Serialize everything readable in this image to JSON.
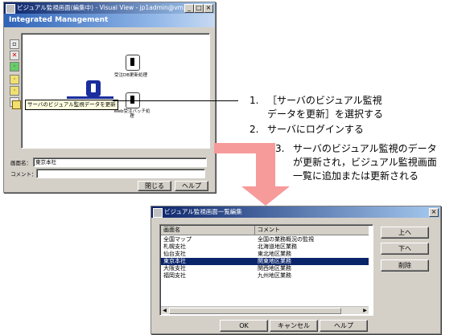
{
  "window1": {
    "title": "ビジュアル監視画面(編集中) - Visual View - jp1admin@vmx078",
    "banner": "Integrated Management",
    "nodes": [
      {
        "label": "受注DB更新処理"
      },
      {
        "label": "Web受注バッチ処理"
      }
    ],
    "tooltip": "サーバのビジュアル監視データを更新",
    "fields": {
      "name_label": "画面名：",
      "name_value": "東京本社",
      "comment_label": "コメント："
    },
    "buttons": {
      "close": "閉じる",
      "help": "ヘルプ"
    }
  },
  "steps": [
    {
      "num": "1.",
      "lines": [
        "［サーバのビジュアル監視",
        "データを更新］を選択する"
      ]
    },
    {
      "num": "2.",
      "lines": [
        "サーバにログインする"
      ]
    },
    {
      "num": "3.",
      "lines": [
        "サーバのビジュアル監視のデータ",
        "が更新され，ビジュアル監視画面",
        "一覧に追加または更新される"
      ]
    }
  ],
  "window2": {
    "title": "ビジュアル監視画面一覧編集",
    "columns": [
      "画面名",
      "コメント"
    ],
    "rows": [
      {
        "name": "全国マップ",
        "comment": "全国の業務概況の監視",
        "selected": false
      },
      {
        "name": "札幌支社",
        "comment": "北海道地区業務",
        "selected": false
      },
      {
        "name": "仙台支社",
        "comment": "東北地区業務",
        "selected": false
      },
      {
        "name": "東京本社",
        "comment": "関東地区業務",
        "selected": true
      },
      {
        "name": "大阪支社",
        "comment": "関西地区業務",
        "selected": false
      },
      {
        "name": "福岡支社",
        "comment": "九州地区業務",
        "selected": false
      }
    ],
    "side_buttons": {
      "up": "上へ",
      "down": "下へ",
      "delete": "削除"
    },
    "buttons": {
      "ok": "OK",
      "cancel": "キャンセル",
      "help": "ヘルプ"
    }
  },
  "colors": {
    "accent": "#0a246a",
    "arrow": "#f79a9a"
  }
}
